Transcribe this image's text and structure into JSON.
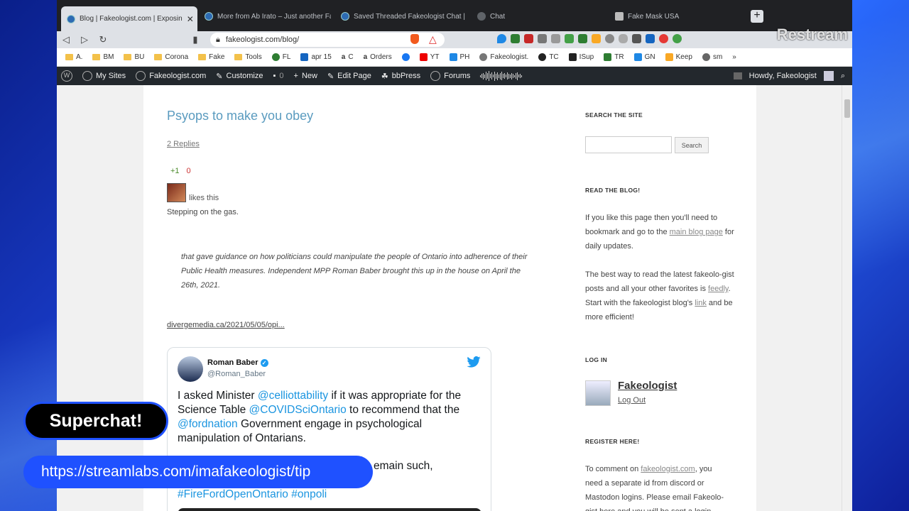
{
  "tabs": [
    {
      "label": "Blog | Fakeologist.com | Exposin",
      "active": true
    },
    {
      "label": "More from Ab Irato – Just another Fa"
    },
    {
      "label": "Saved Threaded Fakeologist Chat | S"
    },
    {
      "label": "Chat"
    },
    {
      "label": "Fake Mask USA"
    }
  ],
  "address": {
    "url": "fakeologist.com/blog/"
  },
  "overlay_brand": "Restream",
  "bookmarks": [
    "A.",
    "BM",
    "BU",
    "Corona",
    "Fake",
    "Tools",
    "FL",
    "apr 15",
    "C",
    "Orders",
    "YT",
    "PH",
    "Fakeologist.",
    "TC",
    "ISup",
    "TR",
    "GN",
    "Keep",
    "sm"
  ],
  "adminbar": {
    "items": [
      "My Sites",
      "Fakeologist.com",
      "Customize",
      "0",
      "New",
      "Edit Page",
      "bbPress",
      "Forums"
    ],
    "greeting": "Howdy, Fakeologist"
  },
  "post": {
    "title": "Psyops to make you obey",
    "replies": "2 Replies",
    "vote_up": "+1",
    "vote_down": "0",
    "likes": "likes this",
    "lead": "Stepping on the gas.",
    "quote": "that gave guidance on how politicians could manipulate the people of Ontario into adherence of their Public Health measures. Independent MPP Roman Baber brought this up in the house on April the 26th, 2021.",
    "source_link": "divergemedia.ca/2021/05/05/opi..."
  },
  "tweet": {
    "name": "Roman Baber",
    "handle": "@Roman_Baber",
    "text_1": "I asked Minister ",
    "mention_1": "@celliottability",
    "text_2": " if it was appropriate for the Science Table ",
    "mention_2": "@COVIDSciOntario",
    "text_3": " to recommend that the ",
    "mention_3": "@fordnation",
    "text_4": " Government engage in psychological manipulation of Ontarians.",
    "partial": "emain such,",
    "hashtags": "#FireFordOpenOntario #onpoli"
  },
  "sidebar": {
    "search_heading": "SEARCH THE SITE",
    "search_button": "Search",
    "read_heading": "READ THE BLOG!",
    "read_p1_a": "If you like this page then you'll need to bookmark and go to the ",
    "read_p1_link": "main blog page",
    "read_p1_b": " for daily updates.",
    "read_p2_a": "The best way to read the latest fakeolo-gist posts and all your other favorites is ",
    "read_p2_link1": "feedly",
    "read_p2_b": ". Start with the fakeologist blog's ",
    "read_p2_link2": "link",
    "read_p2_c": " and be more efficient!",
    "login_heading": "LOG IN",
    "user": "Fakeologist",
    "logout": "Log Out",
    "register_heading": "REGISTER HERE!",
    "register_a": "To comment on ",
    "register_link": "fakeologist.com",
    "register_b": ", you need a separate id from discord or Mastodon logins. Please email Fakeolo-gist here and you will be sent a login"
  },
  "overlays": {
    "superchat": "Superchat!",
    "tip_url": "https://streamlabs.com/imafakeologist/tip"
  },
  "colors": {
    "accent": "#1f51ff",
    "link": "#1b95e0",
    "title": "#5a9bbf",
    "adminbar": "#23282d"
  }
}
